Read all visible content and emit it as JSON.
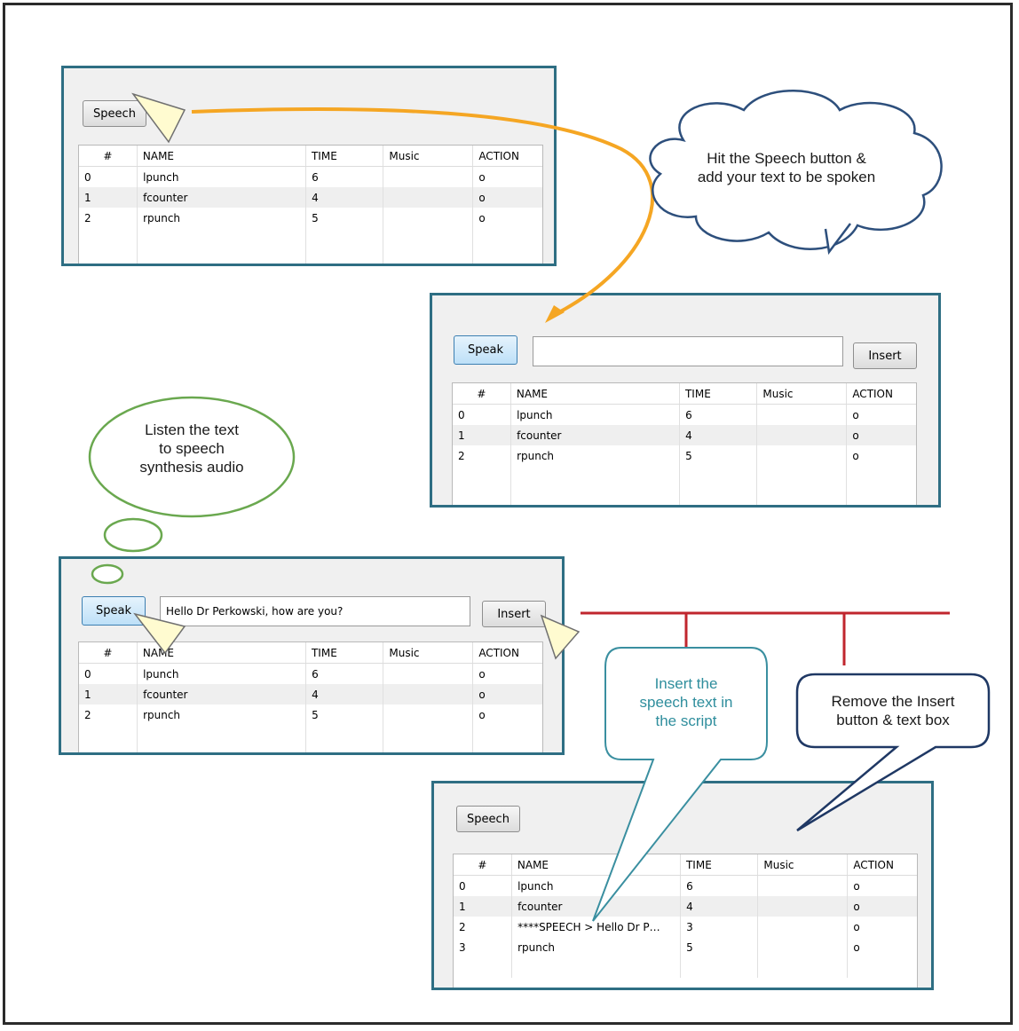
{
  "panels": [
    {
      "id": "panel1",
      "button": "Speech",
      "table": {
        "headers": [
          "#",
          "NAME",
          "TIME",
          "Music",
          "ACTION"
        ],
        "rows": [
          [
            "0",
            "lpunch",
            "6",
            "",
            "o"
          ],
          [
            "1",
            "fcounter",
            "4",
            "",
            "o"
          ],
          [
            "2",
            "rpunch",
            "5",
            "",
            "o"
          ]
        ]
      }
    },
    {
      "id": "panel2",
      "button": "Speak",
      "input_value": "",
      "insert": "Insert",
      "table": {
        "headers": [
          "#",
          "NAME",
          "TIME",
          "Music",
          "ACTION"
        ],
        "rows": [
          [
            "0",
            "lpunch",
            "6",
            "",
            "o"
          ],
          [
            "1",
            "fcounter",
            "4",
            "",
            "o"
          ],
          [
            "2",
            "rpunch",
            "5",
            "",
            "o"
          ]
        ]
      }
    },
    {
      "id": "panel3",
      "button": "Speak",
      "input_value": "Hello Dr Perkowski, how are you?",
      "insert": "Insert",
      "table": {
        "headers": [
          "#",
          "NAME",
          "TIME",
          "Music",
          "ACTION"
        ],
        "rows": [
          [
            "0",
            "lpunch",
            "6",
            "",
            "o"
          ],
          [
            "1",
            "fcounter",
            "4",
            "",
            "o"
          ],
          [
            "2",
            "rpunch",
            "5",
            "",
            "o"
          ]
        ]
      }
    },
    {
      "id": "panel4",
      "button": "Speech",
      "table": {
        "headers": [
          "#",
          "NAME",
          "TIME",
          "Music",
          "ACTION"
        ],
        "rows": [
          [
            "0",
            "lpunch",
            "6",
            "",
            "o"
          ],
          [
            "1",
            "fcounter",
            "4",
            "",
            "o"
          ],
          [
            "2",
            "****SPEECH > Hello Dr P…",
            "3",
            "",
            "o"
          ],
          [
            "3",
            "rpunch",
            "5",
            "",
            "o"
          ]
        ]
      }
    }
  ],
  "annotations": {
    "cloud": [
      "Hit the Speech button &",
      "add your text to be spoken"
    ],
    "thought": [
      "Listen the text",
      "to speech",
      "synthesis audio"
    ],
    "insert_callout": [
      "Insert the",
      "speech text in",
      "the script"
    ],
    "remove_callout": [
      "Remove the Insert",
      "button & text box"
    ]
  },
  "colors": {
    "panel_border": "#2e6e83",
    "cloud_stroke": "#2d4f7c",
    "thought_stroke": "#6aa84f",
    "callout_teal": "#3a8fa0",
    "arrow_orange": "#f5a623",
    "red_line": "#c0262e"
  }
}
